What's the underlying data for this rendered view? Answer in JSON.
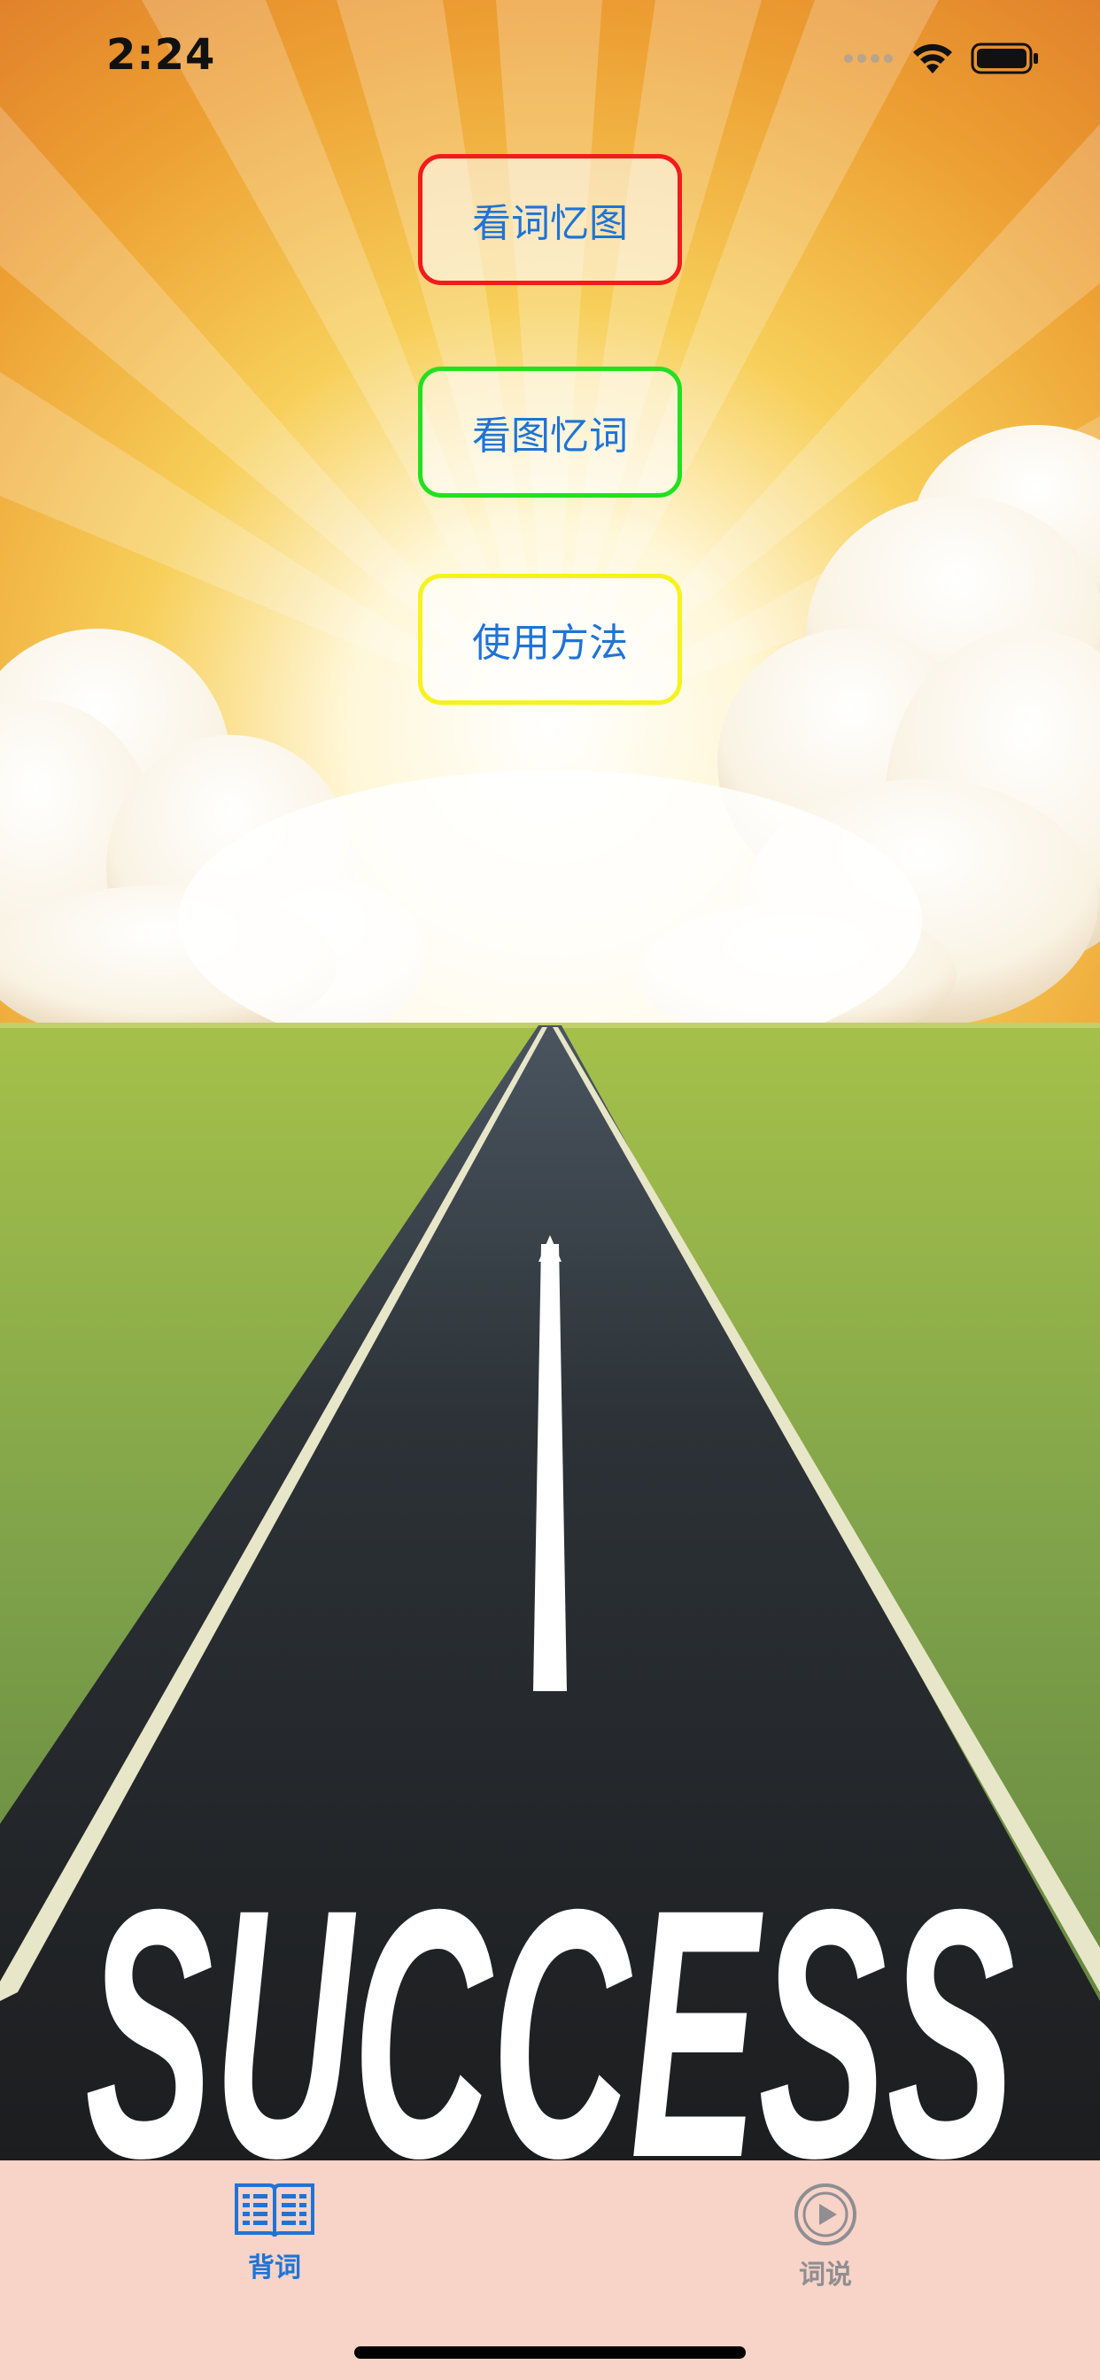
{
  "status_bar": {
    "time": "2:24"
  },
  "menu": {
    "buttons": [
      {
        "label": "看词忆图",
        "border_color": "#f21b1b"
      },
      {
        "label": "看图忆词",
        "border_color": "#22e01f"
      },
      {
        "label": "使用方法",
        "border_color": "#f6f21e"
      }
    ]
  },
  "background": {
    "road_text": "SUCCESS"
  },
  "tab_bar": {
    "items": [
      {
        "label": "背词",
        "icon": "book-icon",
        "selected": true
      },
      {
        "label": "词说",
        "icon": "play-circle-icon",
        "selected": false
      }
    ],
    "active_color": "#1f73d6",
    "inactive_color": "#8e8e93",
    "background": "#f8d3c7"
  }
}
